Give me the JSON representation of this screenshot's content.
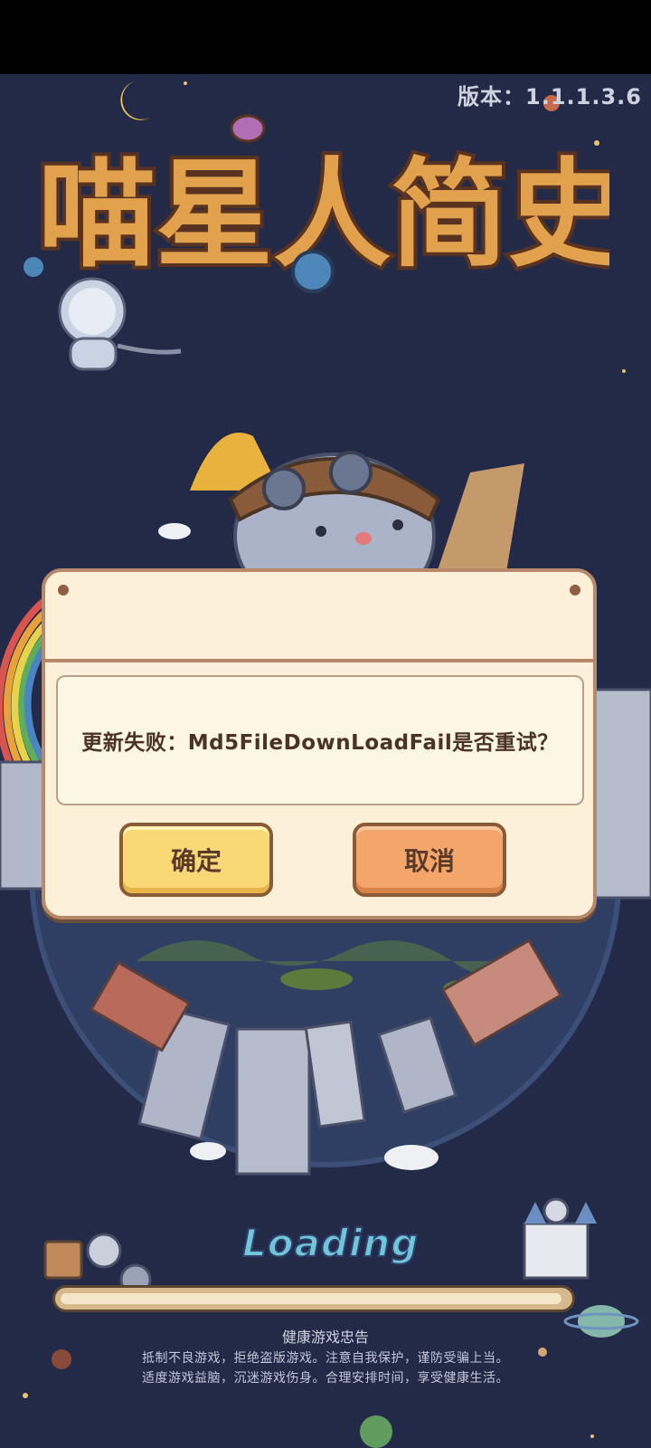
{
  "game": {
    "version": "版本：1.1.1.3.6",
    "logo_text": "喵星人简史",
    "loading_label": "Loading",
    "loading_progress": 0.99
  },
  "dialog": {
    "message": "更新失败：Md5FileDownLoadFail是否重试？",
    "confirm_label": "确定",
    "cancel_label": "取消"
  },
  "health_notice": {
    "title": "健康游戏忠告",
    "line1": "抵制不良游戏，拒绝盗版游戏。注意自我保护，谨防受骗上当。",
    "line2": "适度游戏益脑，沉迷游戏伤身。合理安排时间，享受健康生活。"
  },
  "colors": {
    "background": "#232a48",
    "dialog_bg": "#fcf1d8",
    "confirm_button": "#fbd876",
    "cancel_button": "#f3a56a",
    "loading_text": "#6fc5d9"
  }
}
